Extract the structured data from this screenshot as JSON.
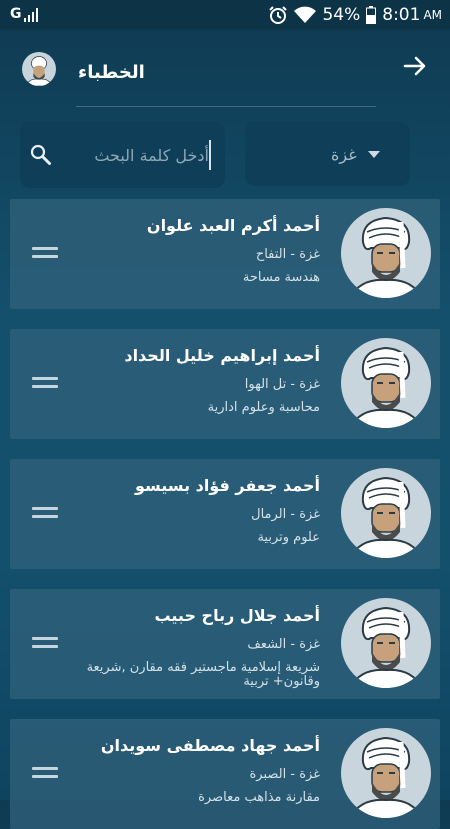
{
  "status_bar": {
    "carrier": "G",
    "battery": "54%",
    "time": "8:01",
    "ampm": "AM"
  },
  "header": {
    "title": "الخطباء"
  },
  "search": {
    "placeholder": "أدخل كلمة البحث"
  },
  "city_filter": {
    "selected": "غزة"
  },
  "preachers": [
    {
      "name": "أحمد أكرم العبد علوان",
      "place": "غزة - التفاح",
      "specialty": "هندسة مساحة"
    },
    {
      "name": "أحمد إبراهيم خليل الحداد",
      "place": "غزة - تل الهوا",
      "specialty": "محاسبة وعلوم ادارية"
    },
    {
      "name": "أحمد جعفر فؤاد بسيسو",
      "place": "غزة - الرمال",
      "specialty": "علوم وتربية"
    },
    {
      "name": "أحمد جلال رباح حبيب",
      "place": "غزة - الشعف",
      "specialty": "شريعة إسلامية ماجستير فقه مقارن ,شريعة وقانون+ تربية"
    },
    {
      "name": "أحمد جهاد مصطفى سويدان",
      "place": "غزة - الصبرة",
      "specialty": "مقارنة مذاهب معاصرة"
    }
  ],
  "icons": {
    "back": "arrow-right-icon",
    "search": "search-icon",
    "dropdown": "triangle-down-icon",
    "handle": "drag-handle-icon",
    "avatar": "sheikh-avatar-icon"
  }
}
